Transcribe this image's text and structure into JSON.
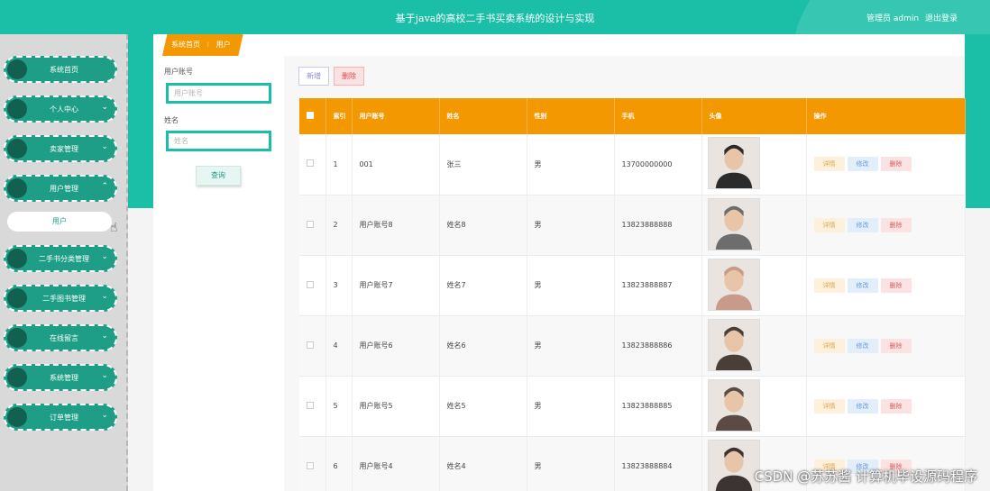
{
  "header": {
    "title": "基于java的高校二手书买卖系统的设计与实现",
    "user_label": "管理员 admin",
    "logout": "退出登录"
  },
  "sidebar": {
    "items": [
      {
        "label": "系统首页",
        "has_arrow": false
      },
      {
        "label": "个人中心",
        "has_arrow": true,
        "arrow": "⌄"
      },
      {
        "label": "卖家管理",
        "has_arrow": true,
        "arrow": "⌄"
      },
      {
        "label": "用户管理",
        "has_arrow": true,
        "arrow": "⌃"
      },
      {
        "label": "二手书分类管理",
        "has_arrow": true,
        "arrow": "⌄"
      },
      {
        "label": "二手图书管理",
        "has_arrow": true,
        "arrow": "⌄"
      },
      {
        "label": "在线留言",
        "has_arrow": true,
        "arrow": "⌄"
      },
      {
        "label": "系统管理",
        "has_arrow": true,
        "arrow": "⌄"
      },
      {
        "label": "订单管理",
        "has_arrow": true,
        "arrow": "⌄"
      }
    ],
    "submenu_label": "用户"
  },
  "breadcrumb": {
    "home": "系统首页",
    "sep": "⁝",
    "current": "用户"
  },
  "search": {
    "account_label": "用户账号",
    "account_placeholder": "用户账号",
    "name_label": "姓名",
    "name_placeholder": "姓名",
    "query_button": "查询"
  },
  "toolbar": {
    "add": "新增",
    "delete": "删除"
  },
  "table": {
    "headers": [
      "索引",
      "用户账号",
      "姓名",
      "性别",
      "手机",
      "头像",
      "操作"
    ],
    "rows": [
      {
        "index": "1",
        "account": "001",
        "name": "张三",
        "gender": "男",
        "phone": "13700000000"
      },
      {
        "index": "2",
        "account": "用户账号8",
        "name": "姓名8",
        "gender": "男",
        "phone": "13823888888"
      },
      {
        "index": "3",
        "account": "用户账号7",
        "name": "姓名7",
        "gender": "男",
        "phone": "13823888887"
      },
      {
        "index": "4",
        "account": "用户账号6",
        "name": "姓名6",
        "gender": "男",
        "phone": "13823888886"
      },
      {
        "index": "5",
        "account": "用户账号5",
        "name": "姓名5",
        "gender": "男",
        "phone": "13823888885"
      },
      {
        "index": "6",
        "account": "用户账号4",
        "name": "姓名4",
        "gender": "男",
        "phone": "13823888884"
      }
    ],
    "actions": {
      "detail": "详情",
      "edit": "修改",
      "delete": "删除"
    }
  },
  "watermark": "CSDN @苏苏酱   计算机毕设源码程序",
  "colors": {
    "teal": "#1bbfa8",
    "orange": "#f39800",
    "menu": "#1e9e86"
  }
}
